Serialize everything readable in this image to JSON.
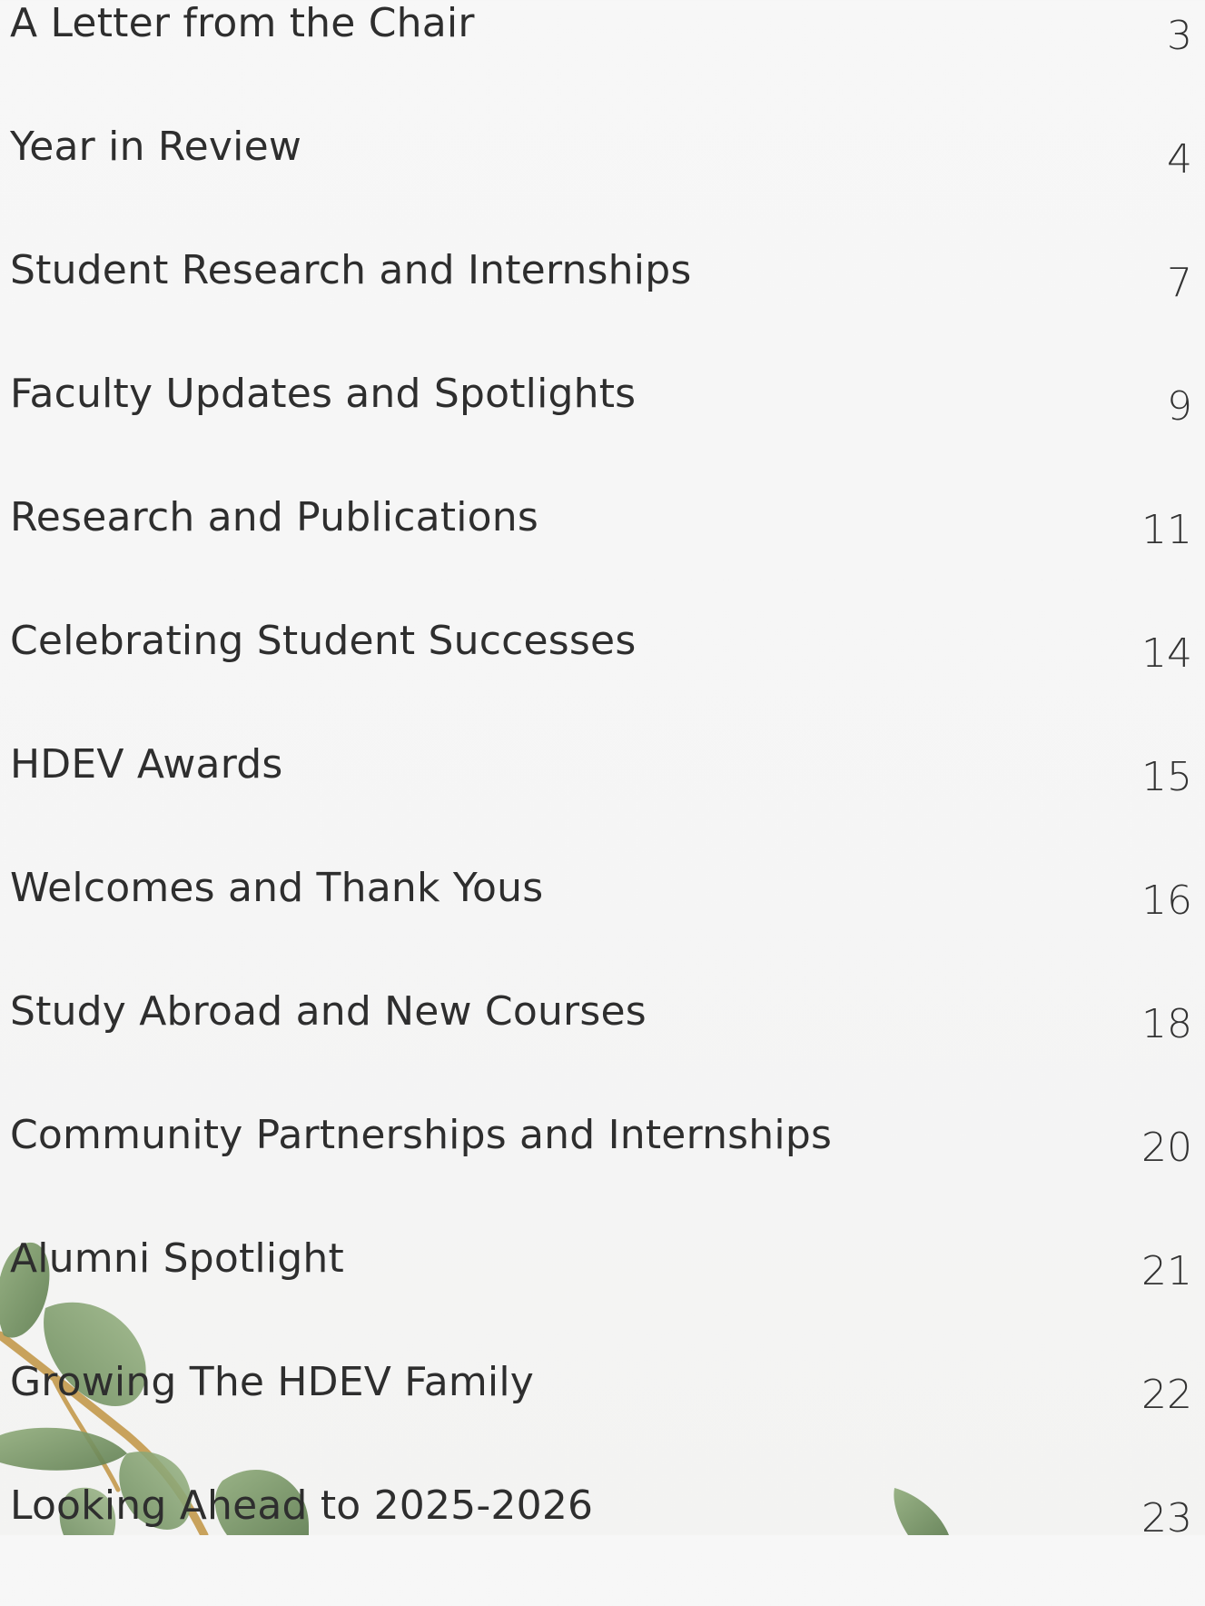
{
  "toc": {
    "entries": [
      {
        "title": "A Letter from the Chair",
        "page": "3"
      },
      {
        "title": "Year in Review",
        "page": "4"
      },
      {
        "title": "Student Research and Internships",
        "page": "7"
      },
      {
        "title": "Faculty Updates and Spotlights",
        "page": "9"
      },
      {
        "title": "Research and Publications",
        "page": "11"
      },
      {
        "title": "Celebrating Student Successes",
        "page": "14"
      },
      {
        "title": "HDEV Awards",
        "page": "15"
      },
      {
        "title": "Welcomes and Thank Yous",
        "page": "16"
      },
      {
        "title": "Study Abroad and New Courses",
        "page": "18"
      },
      {
        "title": "Community Partnerships and Internships",
        "page": "20"
      },
      {
        "title": "Alumni Spotlight",
        "page": "21"
      },
      {
        "title": "Growing The HDEV Family",
        "page": "22"
      },
      {
        "title": "Looking Ahead to 2025-2026",
        "page": "23"
      }
    ]
  },
  "colors": {
    "background": "#f5f5f5",
    "text": "#2e2e2e",
    "leaf": "#7d9b6a",
    "leaf_dark": "#5f7f50",
    "stem": "#c9a25a"
  },
  "decoration": {
    "image": "eucalyptus-branch"
  }
}
